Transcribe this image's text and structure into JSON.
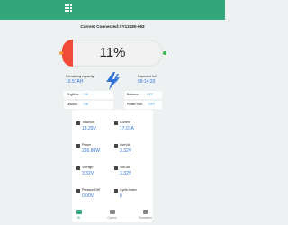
{
  "app": {
    "connection_text": "Current Connected:SY12180-093",
    "battery_percent_text": "11%",
    "battery_fraction": 0.11,
    "colors": {
      "header": "#33a67b",
      "bar_fill": "#f24a39",
      "value_blue": "#2f72d6"
    }
  },
  "capacity": {
    "remaining_label": "Remaining capacity",
    "remaining_value": "10.57AH",
    "expected_label": "Expected full",
    "expected_value": "09:14:20"
  },
  "statuses": [
    {
      "label": "ChgMos:",
      "value": "ON"
    },
    {
      "label": "Balance:",
      "value": "OFF"
    },
    {
      "label": "DisMos:",
      "value": "ON"
    },
    {
      "label": "ProtecTion:",
      "value": "OFF"
    }
  ],
  "metrics": [
    {
      "name": "TotalVolt",
      "value": "13.29V"
    },
    {
      "name": "Current",
      "value": "17.07A"
    },
    {
      "name": "Power",
      "value": "226.86W"
    },
    {
      "name": "AveVol",
      "value": "3.32V"
    },
    {
      "name": "VolHigh",
      "value": "3.32V"
    },
    {
      "name": "VolLow",
      "value": "3.32V"
    },
    {
      "name": "PressureDiff",
      "value": "0.00V"
    },
    {
      "name": "Cycle-Index",
      "value": "0"
    }
  ],
  "nav": [
    {
      "label": "Bt",
      "icon": "home-icon"
    },
    {
      "label": "Control",
      "icon": "control-icon"
    },
    {
      "label": "Parameter",
      "icon": "parameter-icon"
    }
  ]
}
